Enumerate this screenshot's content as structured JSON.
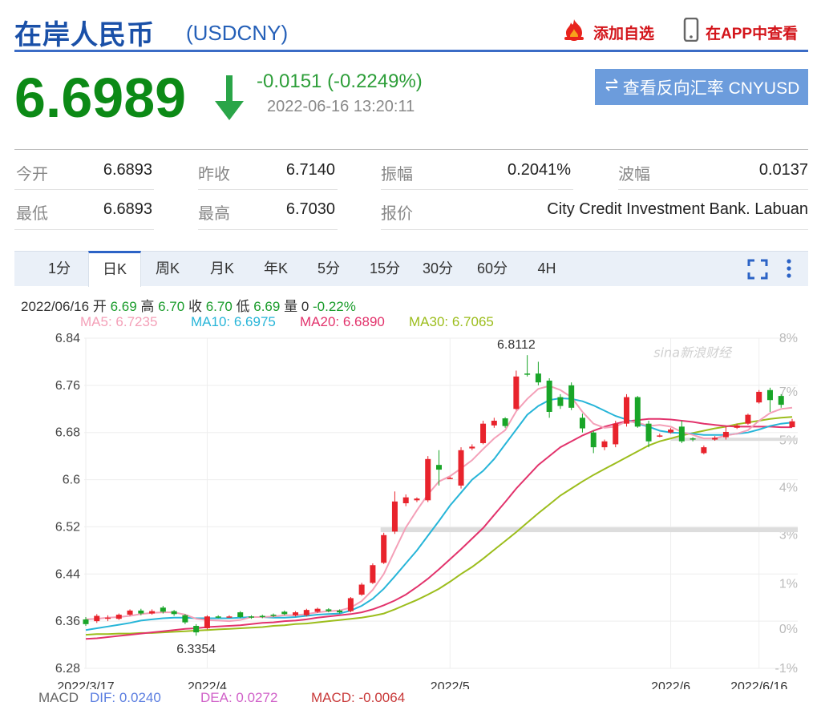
{
  "header": {
    "title": "在岸人民币",
    "code": "(USDCNY)",
    "add_watch": "添加自选",
    "view_app": "在APP中查看"
  },
  "quote": {
    "price": "6.6989",
    "change": "-0.0151 (-0.2249%)",
    "timestamp": "2022-06-16 13:20:11",
    "reverse_button": "查看反向汇率 CNYUSD",
    "trend": "down",
    "color": "#0c8a16"
  },
  "stats": {
    "open_label": "今开",
    "open": "6.6893",
    "prev_close_label": "昨收",
    "prev_close": "6.7140",
    "amplitude_label": "振幅",
    "amplitude": "0.2041%",
    "volatility_label": "波幅",
    "volatility": "0.0137",
    "low_label": "最低",
    "low": "6.6893",
    "high_label": "最高",
    "high": "6.7030",
    "quote_label": "报价",
    "quote_source": "City Credit Investment Bank. Labuan"
  },
  "tabs": [
    "1分",
    "日K",
    "周K",
    "月K",
    "年K",
    "5分",
    "15分",
    "30分",
    "60分",
    "4H"
  ],
  "active_tab": "日K",
  "icons": {
    "fullscreen": "fullscreen-icon",
    "more": "more-vertical-icon",
    "fire": "fire-icon",
    "phone": "phone-icon",
    "swap": "swap-icon",
    "down_arrow": "down-arrow-icon"
  },
  "bar_info": {
    "date": "2022/06/16",
    "open_label": "开",
    "open": "6.69",
    "high_label": "高",
    "high": "6.70",
    "close_label": "收",
    "close": "6.70",
    "low_label": "低",
    "low": "6.69",
    "vol_label": "量",
    "vol": "0",
    "pct": "-0.22%"
  },
  "ma_legend": [
    {
      "label": "MA5: 6.7235",
      "color": "#f4a0b8"
    },
    {
      "label": "MA10: 6.6975",
      "color": "#27b5d8"
    },
    {
      "label": "MA20: 6.6890",
      "color": "#e2336c"
    },
    {
      "label": "MA30: 6.7065",
      "color": "#9cbd1c"
    }
  ],
  "macd_legend": [
    {
      "label": "MACD",
      "color": "#666"
    },
    {
      "label": "DIF: 0.0240",
      "color": "#5a7de0"
    },
    {
      "label": "DEA: 0.0272",
      "color": "#d060c8"
    },
    {
      "label": "MACD: -0.0064",
      "color": "#c83838"
    }
  ],
  "watermark": "sina新浪财经",
  "chart_data": {
    "type": "candlestick",
    "y_ticks": [
      "6.84",
      "6.76",
      "6.68",
      "6.6",
      "6.52",
      "6.44",
      "6.36",
      "6.28"
    ],
    "y_min": 6.28,
    "y_max": 6.84,
    "pct_ticks": [
      "8%",
      "7%",
      "5%",
      "4%",
      "3%",
      "1%",
      "0%",
      "-1%"
    ],
    "x_labels": [
      {
        "label": "2022/3/17",
        "i": 0
      },
      {
        "label": "2022/4",
        "i": 11
      },
      {
        "label": "2022/5",
        "i": 33
      },
      {
        "label": "2022/6",
        "i": 53
      },
      {
        "label": "2022/6/16",
        "i": 61
      }
    ],
    "annotations": [
      {
        "label": "6.8112",
        "i": 39,
        "value": 6.8112,
        "pos": "above"
      },
      {
        "label": "6.3354",
        "i": 10,
        "value": 6.3354,
        "pos": "below"
      }
    ],
    "up_color": "#e8232c",
    "down_color": "#19a528",
    "candles": [
      [
        6.363,
        6.355,
        6.367,
        6.352
      ],
      [
        6.36,
        6.369,
        6.372,
        6.357
      ],
      [
        6.365,
        6.366,
        6.37,
        6.36
      ],
      [
        6.364,
        6.371,
        6.373,
        6.362
      ],
      [
        6.371,
        6.378,
        6.38,
        6.369
      ],
      [
        6.378,
        6.373,
        6.381,
        6.37
      ],
      [
        6.373,
        6.377,
        6.38,
        6.371
      ],
      [
        6.383,
        6.376,
        6.386,
        6.373
      ],
      [
        6.377,
        6.372,
        6.379,
        6.369
      ],
      [
        6.37,
        6.358,
        6.372,
        6.355
      ],
      [
        6.352,
        6.341,
        6.355,
        6.3354
      ],
      [
        6.348,
        6.368,
        6.37,
        6.346
      ],
      [
        6.368,
        6.367,
        6.37,
        6.365
      ],
      [
        6.368,
        6.368,
        6.37,
        6.366
      ],
      [
        6.375,
        6.367,
        6.377,
        6.365
      ],
      [
        6.368,
        6.366,
        6.37,
        6.364
      ],
      [
        6.369,
        6.367,
        6.371,
        6.365
      ],
      [
        6.371,
        6.369,
        6.373,
        6.367
      ],
      [
        6.376,
        6.372,
        6.378,
        6.37
      ],
      [
        6.37,
        6.375,
        6.377,
        6.368
      ],
      [
        6.37,
        6.379,
        6.381,
        6.368
      ],
      [
        6.376,
        6.381,
        6.383,
        6.374
      ],
      [
        6.38,
        6.377,
        6.382,
        6.375
      ],
      [
        6.378,
        6.375,
        6.38,
        6.373
      ],
      [
        6.377,
        6.399,
        6.401,
        6.375
      ],
      [
        6.405,
        6.422,
        6.425,
        6.403
      ],
      [
        6.425,
        6.455,
        6.458,
        6.423
      ],
      [
        6.459,
        6.506,
        6.51,
        6.457
      ],
      [
        6.512,
        6.563,
        6.58,
        6.508
      ],
      [
        6.56,
        6.57,
        6.575,
        6.555
      ],
      [
        6.565,
        6.568,
        6.57,
        6.562
      ],
      [
        6.565,
        6.635,
        6.64,
        6.562
      ],
      [
        6.625,
        6.617,
        6.65,
        6.59
      ],
      [
        6.603,
        6.603,
        6.605,
        6.601
      ],
      [
        6.59,
        6.65,
        6.655,
        6.585
      ],
      [
        6.653,
        6.656,
        6.66,
        6.65
      ],
      [
        6.662,
        6.695,
        6.7,
        6.66
      ],
      [
        6.692,
        6.7,
        6.705,
        6.688
      ],
      [
        6.704,
        6.691,
        6.706,
        6.688
      ],
      [
        6.72,
        6.775,
        6.785,
        6.718
      ],
      [
        6.78,
        6.779,
        6.8112,
        6.775
      ],
      [
        6.78,
        6.765,
        6.8,
        6.76
      ],
      [
        6.768,
        6.715,
        6.772,
        6.705
      ],
      [
        6.74,
        6.725,
        6.745,
        6.72
      ],
      [
        6.76,
        6.722,
        6.765,
        6.718
      ],
      [
        6.705,
        6.687,
        6.712,
        6.68
      ],
      [
        6.68,
        6.655,
        6.683,
        6.645
      ],
      [
        6.655,
        6.665,
        6.668,
        6.65
      ],
      [
        6.66,
        6.695,
        6.7,
        6.655
      ],
      [
        6.695,
        6.74,
        6.745,
        6.69
      ],
      [
        6.74,
        6.69,
        6.742,
        6.688
      ],
      [
        6.695,
        6.665,
        6.7,
        6.655
      ],
      [
        6.675,
        6.675,
        6.678,
        6.672
      ],
      [
        6.68,
        6.685,
        6.688,
        6.678
      ],
      [
        6.69,
        6.665,
        6.7,
        6.662
      ],
      [
        6.67,
        6.668,
        6.672,
        6.665
      ],
      [
        6.645,
        6.655,
        6.658,
        6.643
      ],
      [
        6.668,
        6.671,
        6.674,
        6.666
      ],
      [
        6.672,
        6.681,
        6.69,
        6.668
      ],
      [
        6.688,
        6.692,
        6.695,
        6.686
      ],
      [
        6.695,
        6.71,
        6.712,
        6.693
      ],
      [
        6.731,
        6.749,
        6.752,
        6.729
      ],
      [
        6.752,
        6.735,
        6.756,
        6.715
      ],
      [
        6.742,
        6.727,
        6.745,
        6.722
      ],
      [
        6.689,
        6.699,
        6.703,
        6.689
      ]
    ],
    "ma5": [
      6.363,
      6.364,
      6.366,
      6.367,
      6.369,
      6.372,
      6.374,
      6.375,
      6.375,
      6.371,
      6.364,
      6.362,
      6.361,
      6.36,
      6.362,
      6.367,
      6.367,
      6.368,
      6.37,
      6.37,
      6.372,
      6.375,
      6.377,
      6.378,
      6.383,
      6.394,
      6.413,
      6.44,
      6.48,
      6.519,
      6.548,
      6.575,
      6.597,
      6.606,
      6.619,
      6.633,
      6.652,
      6.67,
      6.684,
      6.716,
      6.737,
      6.754,
      6.759,
      6.752,
      6.74,
      6.715,
      6.695,
      6.688,
      6.69,
      6.699,
      6.697,
      6.691,
      6.693,
      6.69,
      6.681,
      6.676,
      6.67,
      6.67,
      6.675,
      6.678,
      6.684,
      6.7,
      6.713,
      6.72,
      6.722
    ],
    "ma10": [
      6.345,
      6.348,
      6.351,
      6.354,
      6.357,
      6.361,
      6.363,
      6.365,
      6.366,
      6.366,
      6.365,
      6.365,
      6.365,
      6.365,
      6.366,
      6.367,
      6.367,
      6.366,
      6.366,
      6.367,
      6.369,
      6.371,
      6.372,
      6.373,
      6.378,
      6.386,
      6.398,
      6.415,
      6.436,
      6.458,
      6.48,
      6.505,
      6.53,
      6.556,
      6.578,
      6.6,
      6.615,
      6.635,
      6.66,
      6.685,
      6.71,
      6.725,
      6.735,
      6.738,
      6.737,
      6.733,
      6.726,
      6.717,
      6.708,
      6.702,
      6.695,
      6.69,
      6.683,
      6.68,
      6.679,
      6.678,
      6.676,
      6.676,
      6.676,
      6.678,
      6.68,
      6.685,
      6.691,
      6.695,
      6.697
    ],
    "ma20": [
      6.33,
      6.331,
      6.333,
      6.335,
      6.337,
      6.339,
      6.341,
      6.343,
      6.345,
      6.347,
      6.348,
      6.35,
      6.351,
      6.352,
      6.353,
      6.355,
      6.357,
      6.358,
      6.36,
      6.361,
      6.363,
      6.366,
      6.368,
      6.37,
      6.372,
      6.375,
      6.38,
      6.387,
      6.395,
      6.405,
      6.418,
      6.432,
      6.448,
      6.465,
      6.482,
      6.5,
      6.518,
      6.54,
      6.562,
      6.585,
      6.605,
      6.625,
      6.64,
      6.655,
      6.665,
      6.675,
      6.683,
      6.69,
      6.695,
      6.699,
      6.701,
      6.703,
      6.703,
      6.702,
      6.7,
      6.698,
      6.695,
      6.693,
      6.691,
      6.69,
      6.69,
      6.69,
      6.69,
      6.689,
      6.689
    ],
    "ma30": [
      6.337,
      6.338,
      6.338,
      6.339,
      6.339,
      6.34,
      6.34,
      6.341,
      6.342,
      6.343,
      6.344,
      6.345,
      6.346,
      6.347,
      6.348,
      6.349,
      6.35,
      6.352,
      6.353,
      6.355,
      6.356,
      6.358,
      6.36,
      6.362,
      6.364,
      6.366,
      6.369,
      6.373,
      6.38,
      6.388,
      6.396,
      6.405,
      6.415,
      6.427,
      6.44,
      6.452,
      6.466,
      6.481,
      6.496,
      6.511,
      6.527,
      6.543,
      6.558,
      6.573,
      6.585,
      6.597,
      6.608,
      6.618,
      6.628,
      6.638,
      6.648,
      6.658,
      6.665,
      6.67,
      6.675,
      6.679,
      6.683,
      6.687,
      6.69,
      6.694,
      6.697,
      6.7,
      6.703,
      6.705,
      6.7065
    ]
  }
}
